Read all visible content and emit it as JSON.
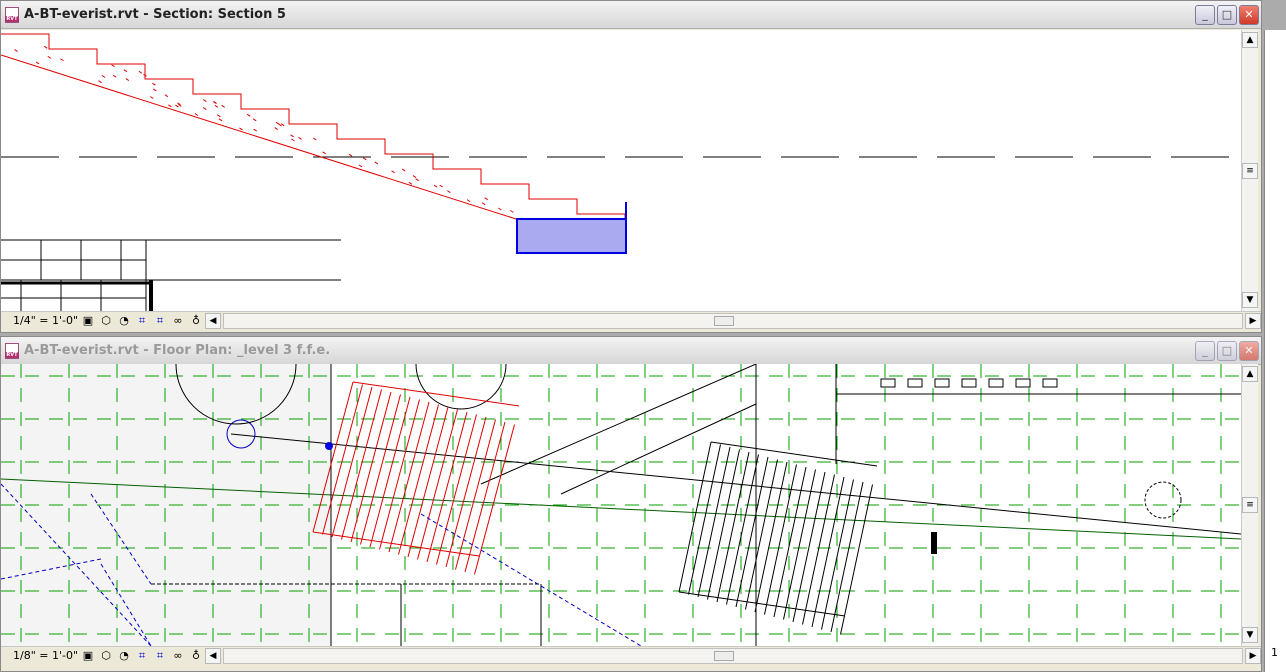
{
  "windows": [
    {
      "title": "A-BT-everist.rvt - Section: Section 5",
      "scale": "1/4\" = 1'-0\"",
      "active": true
    },
    {
      "title": "A-BT-everist.rvt - Floor Plan: _level 3 f.f.e.",
      "scale": "1/8\" = 1'-0\"",
      "active": false
    }
  ],
  "side_window": {
    "scale_fragment": "1"
  },
  "controls": {
    "minimize": "_",
    "maximize": "□",
    "close": "✕"
  },
  "colors": {
    "selection": "#e00000",
    "grid": "#00a000",
    "fill_blue": "#aaaaf0"
  }
}
